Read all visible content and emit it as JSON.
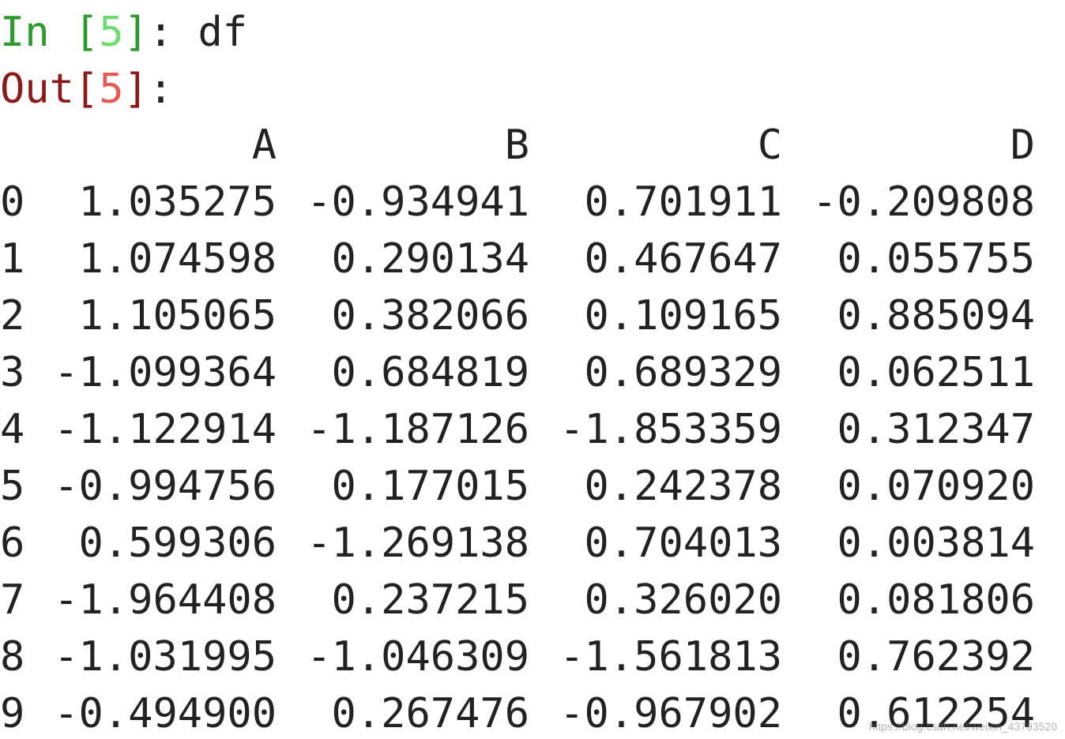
{
  "cell": {
    "in_prefix": "In",
    "in_open": " [",
    "exec_count": "5",
    "in_close": "]",
    "in_colon": ":",
    "code": " df",
    "out_prefix": "Out",
    "out_open": "[",
    "out_close": "]",
    "out_colon": ":"
  },
  "dataframe": {
    "index_header": "",
    "columns": [
      "A",
      "B",
      "C",
      "D"
    ],
    "rows": [
      {
        "index": "0",
        "values": [
          "1.035275",
          "-0.934941",
          "0.701911",
          "-0.209808"
        ]
      },
      {
        "index": "1",
        "values": [
          "1.074598",
          "0.290134",
          "0.467647",
          "0.055755"
        ]
      },
      {
        "index": "2",
        "values": [
          "1.105065",
          "0.382066",
          "0.109165",
          "0.885094"
        ]
      },
      {
        "index": "3",
        "values": [
          "-1.099364",
          "0.684819",
          "0.689329",
          "0.062511"
        ]
      },
      {
        "index": "4",
        "values": [
          "-1.122914",
          "-1.187126",
          "-1.853359",
          "0.312347"
        ]
      },
      {
        "index": "5",
        "values": [
          "-0.994756",
          "0.177015",
          "0.242378",
          "0.070920"
        ]
      },
      {
        "index": "6",
        "values": [
          "0.599306",
          "-1.269138",
          "0.704013",
          "0.003814"
        ]
      },
      {
        "index": "7",
        "values": [
          "-1.964408",
          "0.237215",
          "0.326020",
          "0.081806"
        ]
      },
      {
        "index": "8",
        "values": [
          "-1.031995",
          "-1.046309",
          "-1.561813",
          "0.762392"
        ]
      },
      {
        "index": "9",
        "values": [
          "-0.494900",
          "0.267476",
          "-0.967902",
          "0.612254"
        ]
      }
    ]
  },
  "watermark": "https://blog.csdn.net/weixin_43793520"
}
